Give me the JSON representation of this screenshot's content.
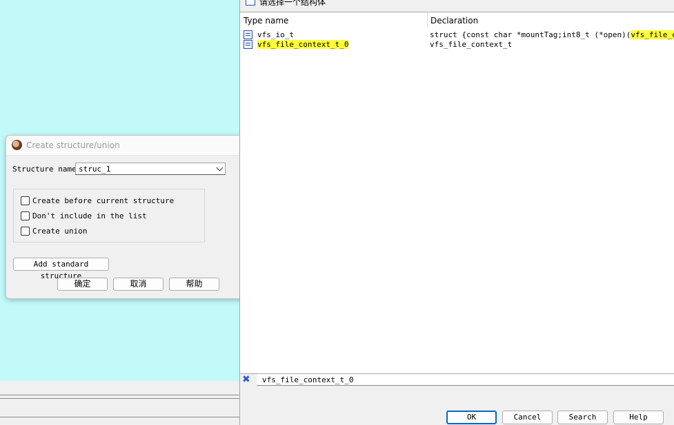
{
  "create_dialog": {
    "title": "Create structure/union",
    "structure_name_label": "Structure name",
    "structure_name_value": "struc_1",
    "checkboxes": [
      {
        "label": "Create before current structure",
        "checked": false
      },
      {
        "label": "Don't include in the list",
        "checked": false
      },
      {
        "label": "Create union",
        "checked": false
      }
    ],
    "add_standard_label": "Add standard structure",
    "ok_label": "确定",
    "cancel_label": "取消",
    "help_label": "帮助"
  },
  "chooser": {
    "title": "请选择一个结构体",
    "columns": [
      "Type name",
      "Declaration"
    ],
    "rows": [
      {
        "type_name": "vfs_io_t",
        "decl_prefix": "struct {const char *mountTag;int8_t (*open)(",
        "decl_highlight": "vfs_file_conte…",
        "highlight_name": false
      },
      {
        "type_name": "vfs_file_context_t_0",
        "decl_prefix": "vfs_file_context_t",
        "decl_highlight": "",
        "highlight_name": true
      }
    ],
    "filter_text": "vfs_file_context_t_0",
    "buttons": {
      "ok": "OK",
      "cancel": "Cancel",
      "search": "Search",
      "help": "Help"
    },
    "highlight_color": "#ffff3a"
  },
  "colors": {
    "desktop": "#c2fafa",
    "dialog_bg": "#f0f0f0",
    "accent": "#0067c0"
  }
}
